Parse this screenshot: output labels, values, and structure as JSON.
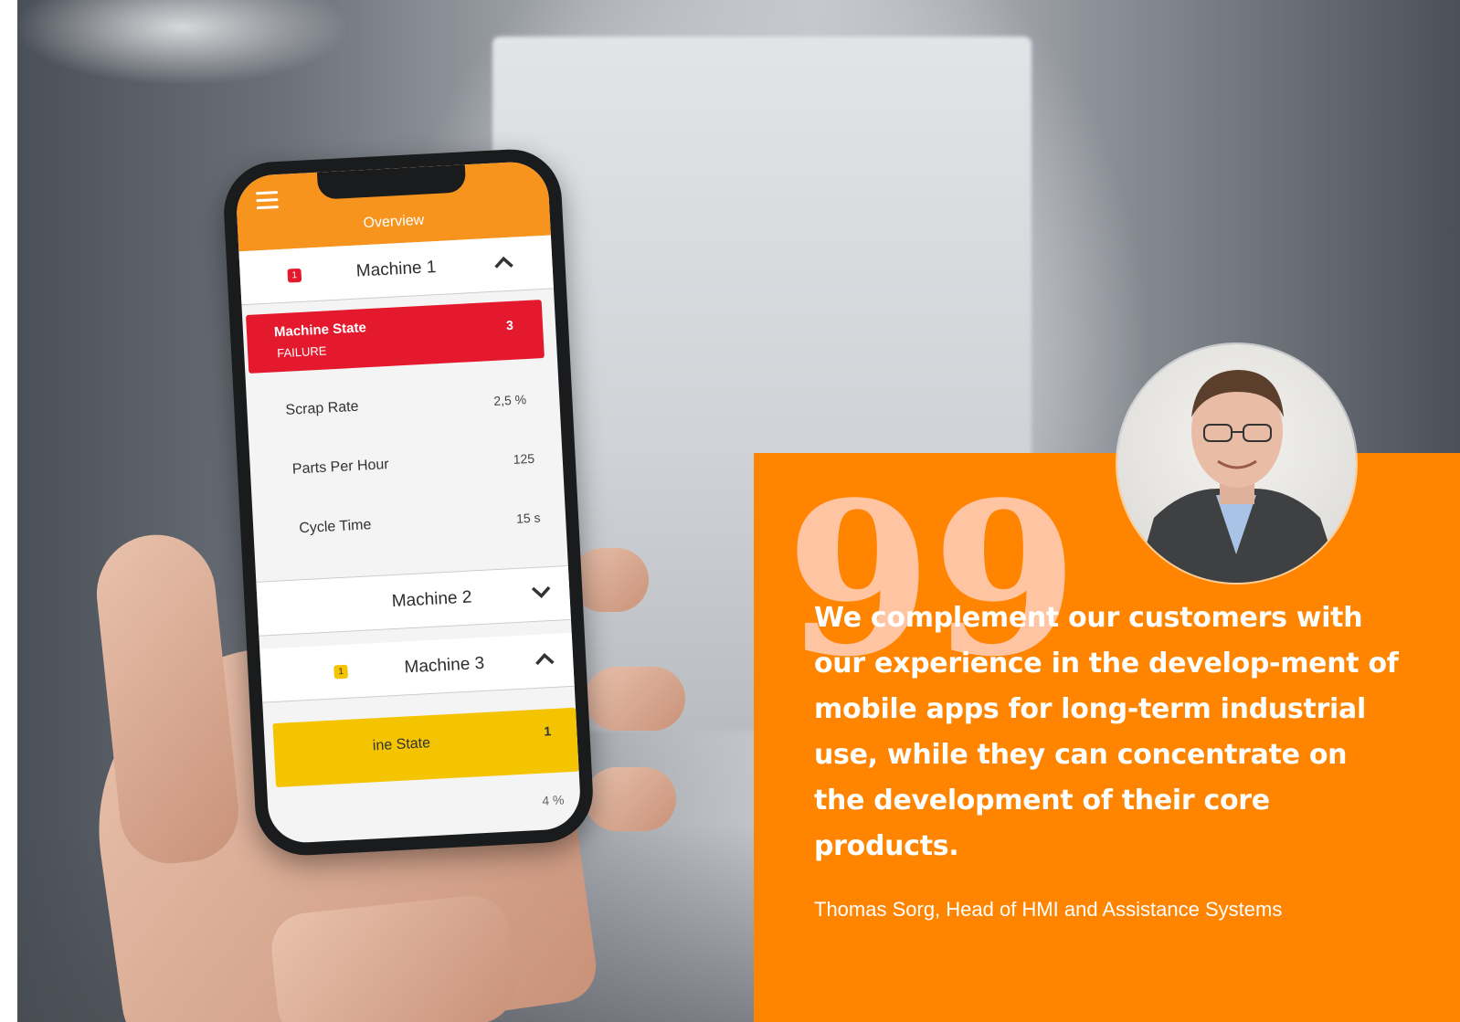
{
  "app": {
    "title": "Overview",
    "machines": [
      {
        "name": "Machine 1",
        "badge": "1",
        "badge_color": "#e4192e",
        "expanded": true,
        "state": {
          "label": "Machine State",
          "value": "FAILURE",
          "count": "3",
          "color": "#e4192e"
        },
        "metrics": [
          {
            "label": "Scrap Rate",
            "value": "2,5 %"
          },
          {
            "label": "Parts Per Hour",
            "value": "125"
          },
          {
            "label": "Cycle Time",
            "value": "15 s"
          }
        ]
      },
      {
        "name": "Machine 2",
        "expanded": false
      },
      {
        "name": "Machine 3",
        "badge": "1",
        "badge_color": "#f5c400",
        "expanded": true,
        "state": {
          "label": "ine State",
          "count": "1",
          "color": "#f5c400"
        },
        "partial_value": "4 %"
      }
    ]
  },
  "quote": {
    "text": "We complement our customers with our experience in the develop-ment of mobile apps for long-term industrial use, while they can concentrate on the development of their core products.",
    "attribution": "Thomas Sorg, Head of HMI and Assistance Systems",
    "mark": "99"
  },
  "colors": {
    "accent": "#ff8400",
    "app_bar": "#f7941d",
    "quote_mark": "#ffc4a1"
  }
}
